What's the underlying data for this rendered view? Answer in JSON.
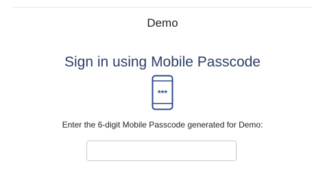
{
  "header": {
    "organization_name": "Demo"
  },
  "main": {
    "title": "Sign in using Mobile Passcode",
    "icon": "mobile-phone-passcode-icon",
    "icon_screen_text": "***",
    "instruction": "Enter the 6-digit Mobile Passcode generated for Demo:",
    "passcode_input": {
      "value": "",
      "placeholder": ""
    }
  },
  "colors": {
    "title": "#2c3e67",
    "icon": "#2d4a8c",
    "text": "#1f1f1f",
    "input_border": "#c8c8c8"
  }
}
